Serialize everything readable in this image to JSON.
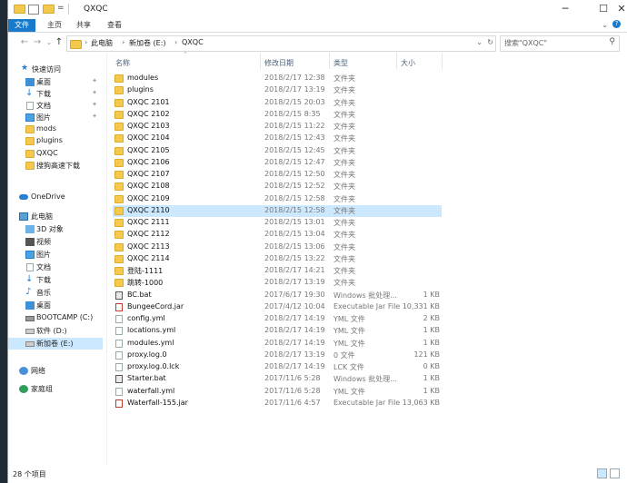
{
  "window": {
    "title": "QXQC"
  },
  "quick_access_toolbar": {
    "undo": "↶",
    "pin_label": "="
  },
  "ribbon_tabs": [
    "文件",
    "主页",
    "共享",
    "查看"
  ],
  "navigation": {
    "back": "←",
    "forward": "→",
    "recent": "⌄",
    "up": "↑",
    "breadcrumb": [
      "此电脑",
      "新加卷 (E:)",
      "QXQC"
    ],
    "search_placeholder": "搜索\"QXQC\""
  },
  "sidebar": {
    "quick_access": "快速访问",
    "quick_items": [
      {
        "label": "桌面",
        "pinned": true
      },
      {
        "label": "下载",
        "pinned": true
      },
      {
        "label": "文档",
        "pinned": true
      },
      {
        "label": "图片",
        "pinned": true
      },
      {
        "label": "mods",
        "pinned": false
      },
      {
        "label": "plugins",
        "pinned": false
      },
      {
        "label": "QXQC",
        "pinned": false
      },
      {
        "label": "搜狗高速下载",
        "pinned": false
      }
    ],
    "onedrive": "OneDrive",
    "this_pc": "此电脑",
    "pc_items": [
      "3D 对象",
      "视频",
      "图片",
      "文档",
      "下载",
      "音乐",
      "桌面",
      "BOOTCAMP (C:)",
      "软件 (D:)",
      "新加卷 (E:)"
    ],
    "network": "网络",
    "homegroup": "家庭组"
  },
  "columns": {
    "name": "名称",
    "date": "修改日期",
    "type": "类型",
    "size": "大小"
  },
  "files": [
    {
      "name": "modules",
      "date": "2018/2/17 12:38",
      "type": "文件夹",
      "size": "",
      "kind": "folder"
    },
    {
      "name": "plugins",
      "date": "2018/2/17 13:19",
      "type": "文件夹",
      "size": "",
      "kind": "folder"
    },
    {
      "name": "QXQC 2101",
      "date": "2018/2/15 20:03",
      "type": "文件夹",
      "size": "",
      "kind": "folder"
    },
    {
      "name": "QXQC 2102",
      "date": "2018/2/15 8:35",
      "type": "文件夹",
      "size": "",
      "kind": "folder"
    },
    {
      "name": "QXQC 2103",
      "date": "2018/2/15 11:22",
      "type": "文件夹",
      "size": "",
      "kind": "folder"
    },
    {
      "name": "QXQC 2104",
      "date": "2018/2/15 12:43",
      "type": "文件夹",
      "size": "",
      "kind": "folder"
    },
    {
      "name": "QXQC 2105",
      "date": "2018/2/15 12:45",
      "type": "文件夹",
      "size": "",
      "kind": "folder"
    },
    {
      "name": "QXQC 2106",
      "date": "2018/2/15 12:47",
      "type": "文件夹",
      "size": "",
      "kind": "folder"
    },
    {
      "name": "QXQC 2107",
      "date": "2018/2/15 12:50",
      "type": "文件夹",
      "size": "",
      "kind": "folder"
    },
    {
      "name": "QXQC 2108",
      "date": "2018/2/15 12:52",
      "type": "文件夹",
      "size": "",
      "kind": "folder"
    },
    {
      "name": "QXQC 2109",
      "date": "2018/2/15 12:58",
      "type": "文件夹",
      "size": "",
      "kind": "folder"
    },
    {
      "name": "QXQC 2110",
      "date": "2018/2/15 12:58",
      "type": "文件夹",
      "size": "",
      "kind": "folder",
      "selected": true
    },
    {
      "name": "QXQC 2111",
      "date": "2018/2/15 13:01",
      "type": "文件夹",
      "size": "",
      "kind": "folder"
    },
    {
      "name": "QXQC 2112",
      "date": "2018/2/15 13:04",
      "type": "文件夹",
      "size": "",
      "kind": "folder"
    },
    {
      "name": "QXQC 2113",
      "date": "2018/2/15 13:06",
      "type": "文件夹",
      "size": "",
      "kind": "folder"
    },
    {
      "name": "QXQC 2114",
      "date": "2018/2/15 13:22",
      "type": "文件夹",
      "size": "",
      "kind": "folder"
    },
    {
      "name": "登陆-1111",
      "date": "2018/2/17 14:21",
      "type": "文件夹",
      "size": "",
      "kind": "folder"
    },
    {
      "name": "跳转-1000",
      "date": "2018/2/17 13:19",
      "type": "文件夹",
      "size": "",
      "kind": "folder"
    },
    {
      "name": "BC.bat",
      "date": "2017/6/17 19:30",
      "type": "Windows 批处理...",
      "size": "1 KB",
      "kind": "bat"
    },
    {
      "name": "BungeeCord.jar",
      "date": "2017/4/12 10:04",
      "type": "Executable Jar File",
      "size": "10,331 KB",
      "kind": "jar"
    },
    {
      "name": "config.yml",
      "date": "2018/2/17 14:19",
      "type": "YML 文件",
      "size": "2 KB",
      "kind": "file"
    },
    {
      "name": "locations.yml",
      "date": "2018/2/17 14:19",
      "type": "YML 文件",
      "size": "1 KB",
      "kind": "file"
    },
    {
      "name": "modules.yml",
      "date": "2018/2/17 14:19",
      "type": "YML 文件",
      "size": "1 KB",
      "kind": "file"
    },
    {
      "name": "proxy.log.0",
      "date": "2018/2/17 13:19",
      "type": "0 文件",
      "size": "121 KB",
      "kind": "file"
    },
    {
      "name": "proxy.log.0.lck",
      "date": "2018/2/17 14:19",
      "type": "LCK 文件",
      "size": "0 KB",
      "kind": "file"
    },
    {
      "name": "Starter.bat",
      "date": "2017/11/6 5:28",
      "type": "Windows 批处理...",
      "size": "1 KB",
      "kind": "bat"
    },
    {
      "name": "waterfall.yml",
      "date": "2017/11/6 5:28",
      "type": "YML 文件",
      "size": "1 KB",
      "kind": "file"
    },
    {
      "name": "Waterfall-155.jar",
      "date": "2017/11/6 4:57",
      "type": "Executable Jar File",
      "size": "13,063 KB",
      "kind": "jar"
    }
  ],
  "status_bar": {
    "item_count": "28 个项目"
  },
  "colors": {
    "accent": "#1979ca",
    "folder": "#f5c94e",
    "selection": "#cce8ff"
  }
}
